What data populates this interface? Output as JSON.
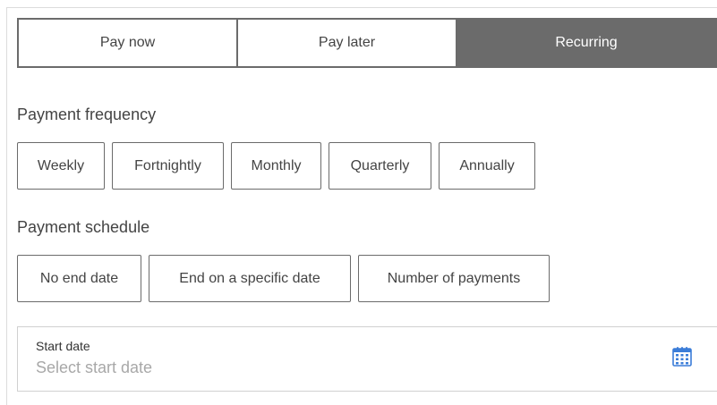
{
  "payment_tabs": {
    "items": [
      {
        "label": "Pay now"
      },
      {
        "label": "Pay later"
      },
      {
        "label": "Recurring"
      }
    ],
    "active": "Recurring"
  },
  "frequency": {
    "label": "Payment frequency",
    "options": [
      {
        "label": "Weekly"
      },
      {
        "label": "Fortnightly"
      },
      {
        "label": "Monthly"
      },
      {
        "label": "Quarterly"
      },
      {
        "label": "Annually"
      }
    ]
  },
  "schedule": {
    "label": "Payment schedule",
    "options": [
      {
        "label": "No end date"
      },
      {
        "label": "End on a specific date"
      },
      {
        "label": "Number of payments"
      }
    ]
  },
  "start_date": {
    "label": "Start date",
    "placeholder": "Select start date",
    "value": "",
    "icon": "calendar-icon"
  },
  "colors": {
    "active_tab_bg": "#6b6b6b",
    "border": "#6b6b6b",
    "text": "#444444",
    "placeholder": "#a8a8a8",
    "calendar_icon": "#3b7dd8"
  }
}
